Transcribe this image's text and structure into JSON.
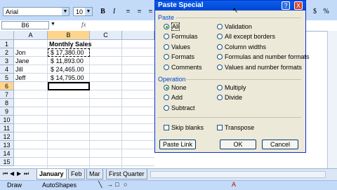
{
  "toolbar": {
    "font": "Arial",
    "size": "10",
    "bold": "B",
    "italic": "I"
  },
  "formula_bar": {
    "name_box": "B6",
    "fx": "fx"
  },
  "grid": {
    "columns": [
      "A",
      "B",
      "C"
    ],
    "rows": [
      "1",
      "2",
      "3",
      "4",
      "5",
      "6",
      "7",
      "8",
      "9",
      "10",
      "11",
      "12",
      "13",
      "14",
      "15"
    ],
    "header_title": "Monthly Sales",
    "names": [
      "Jon",
      "Jane",
      "Jill",
      "Jeff"
    ],
    "values": [
      "$ 17,380.00",
      "$ 11,893.00",
      "$ 24,465.00",
      "$ 14,795.00"
    ]
  },
  "sheet_tabs": [
    "January",
    "Feb",
    "Mar",
    "First Quarter"
  ],
  "drawbar": {
    "draw": "Draw",
    "autoshapes": "AutoShapes"
  },
  "dialog": {
    "title": "Paste Special",
    "paste_group": "Paste",
    "paste_options_left": [
      "All",
      "Formulas",
      "Values",
      "Formats",
      "Comments"
    ],
    "paste_options_right": [
      "Validation",
      "All except borders",
      "Column widths",
      "Formulas and number formats",
      "Values and number formats"
    ],
    "operation_group": "Operation",
    "operation_left": [
      "None",
      "Add",
      "Subtract"
    ],
    "operation_right": [
      "Multiply",
      "Divide"
    ],
    "skip_blanks": "Skip blanks",
    "transpose": "Transpose",
    "paste_link": "Paste Link",
    "ok": "OK",
    "cancel": "Cancel",
    "help": "?",
    "close": "X"
  }
}
